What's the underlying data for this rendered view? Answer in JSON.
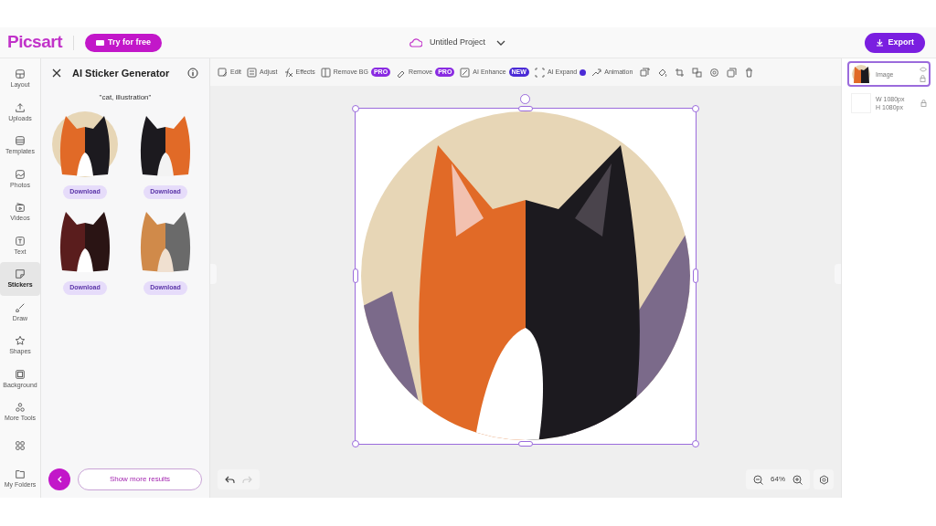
{
  "header": {
    "logo": "Picsart",
    "try_button": "Try for free",
    "project_title": "Untitled Project",
    "export_button": "Export"
  },
  "rail": [
    {
      "label": "Layout",
      "selected": false
    },
    {
      "label": "Uploads",
      "selected": false
    },
    {
      "label": "Templates",
      "selected": false
    },
    {
      "label": "Photos",
      "selected": false
    },
    {
      "label": "Videos",
      "selected": false
    },
    {
      "label": "Text",
      "selected": false
    },
    {
      "label": "Stickers",
      "selected": true
    },
    {
      "label": "Draw",
      "selected": false
    },
    {
      "label": "Shapes",
      "selected": false
    },
    {
      "label": "Background",
      "selected": false
    },
    {
      "label": "More Tools",
      "selected": false
    },
    {
      "selected": false
    }
  ],
  "rail_bottom": {
    "label": "My Folders"
  },
  "panel": {
    "title": "AI Sticker Generator",
    "prompt": "\"cat, illustration\"",
    "results": [
      {
        "download": "Download",
        "kind": "circle"
      },
      {
        "download": "Download",
        "kind": "cutout"
      },
      {
        "download": "Download",
        "kind": "cutout"
      },
      {
        "download": "Download",
        "kind": "cutout"
      }
    ],
    "show_more": "Show more results"
  },
  "toolbar": [
    {
      "label": "Edit"
    },
    {
      "label": "Adjust"
    },
    {
      "label": "Effects"
    },
    {
      "label": "Remove BG",
      "badge": "PRO"
    },
    {
      "label": "Remove",
      "badge": "PRO"
    },
    {
      "label": "AI Enhance",
      "badge": "NEW"
    },
    {
      "label": "AI Expand",
      "dot": true
    },
    {
      "label": "Animation"
    }
  ],
  "zoom": {
    "value": "64%"
  },
  "layers": [
    {
      "name": "Image",
      "selected": true
    },
    {
      "width": "W 1080px",
      "height": "H 1080px",
      "selected": false
    }
  ]
}
